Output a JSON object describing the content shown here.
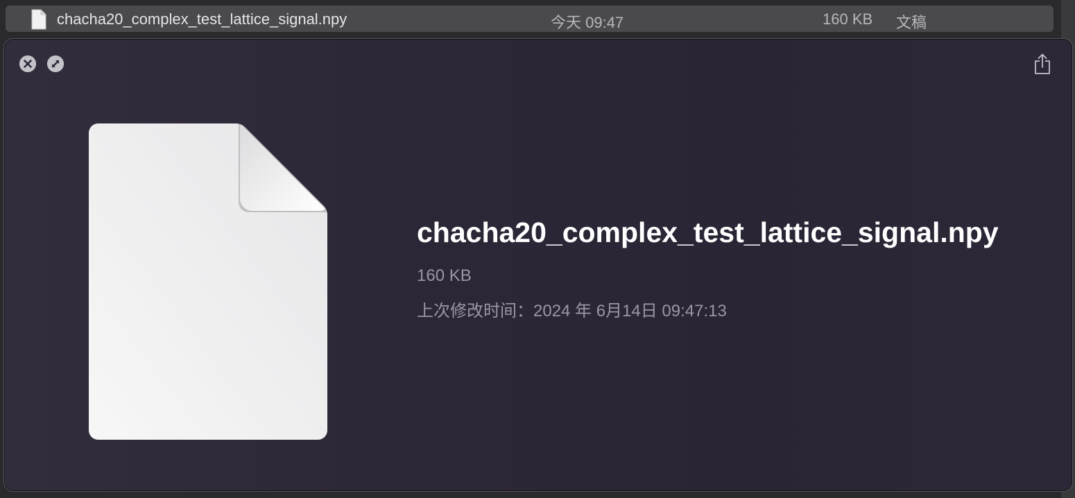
{
  "finder_row": {
    "filename": "chacha20_complex_test_lattice_signal.npy",
    "date": "今天 09:47",
    "size": "160 KB",
    "kind": "文稿",
    "icon": "document-icon"
  },
  "quicklook": {
    "close_icon": "close-icon",
    "fullscreen_icon": "fullscreen-icon",
    "share_icon": "share-icon",
    "document_icon": "generic-document-icon",
    "title": "chacha20_complex_test_lattice_signal.npy",
    "size": "160 KB",
    "modified": "上次修改时间：2024 年 6月14日 09:47:13"
  },
  "colors": {
    "panel_bg": "#2c2737",
    "finder_row_bg": "#4a4a4d",
    "title": "#ffffff",
    "secondary_text": "#9a96a3"
  }
}
